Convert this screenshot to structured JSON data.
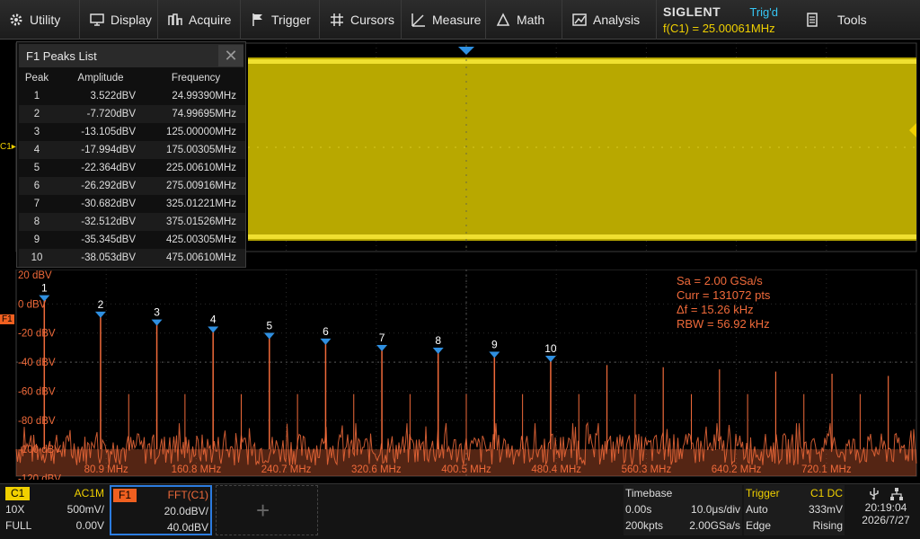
{
  "menu": [
    {
      "label": "Utility",
      "icon": "gear-icon"
    },
    {
      "label": "Display",
      "icon": "monitor-icon"
    },
    {
      "label": "Acquire",
      "icon": "acquire-icon"
    },
    {
      "label": "Trigger",
      "icon": "flag-icon"
    },
    {
      "label": "Cursors",
      "icon": "cursor-grid-icon"
    },
    {
      "label": "Measure",
      "icon": "measure-icon"
    },
    {
      "label": "Math",
      "icon": "math-icon"
    },
    {
      "label": "Analysis",
      "icon": "analysis-icon"
    },
    {
      "label": "Tools",
      "icon": "tools-icon"
    }
  ],
  "brand": {
    "logo": "SIGLENT",
    "status": "Trig'd",
    "freq": "f(C1) = 25.00061MHz"
  },
  "peaks_list": {
    "title": "F1 Peaks List",
    "columns": [
      "Peak",
      "Amplitude",
      "Frequency"
    ],
    "rows": [
      [
        "1",
        "3.522dBV",
        "24.99390MHz"
      ],
      [
        "2",
        "-7.720dBV",
        "74.99695MHz"
      ],
      [
        "3",
        "-13.105dBV",
        "125.00000MHz"
      ],
      [
        "4",
        "-17.994dBV",
        "175.00305MHz"
      ],
      [
        "5",
        "-22.364dBV",
        "225.00610MHz"
      ],
      [
        "6",
        "-26.292dBV",
        "275.00916MHz"
      ],
      [
        "7",
        "-30.682dBV",
        "325.01221MHz"
      ],
      [
        "8",
        "-32.512dBV",
        "375.01526MHz"
      ],
      [
        "9",
        "-35.345dBV",
        "425.00305MHz"
      ],
      [
        "10",
        "-38.053dBV",
        "475.00610MHz"
      ]
    ]
  },
  "markers": {
    "c1": "C1",
    "f1": "F1"
  },
  "fft_info": {
    "sa": "Sa =  2.00 GSa/s",
    "curr": "Curr = 131072 pts",
    "df": "Δf =  15.26 kHz",
    "rbw": "RBW =  56.92 kHz"
  },
  "chart_data": {
    "type": "line",
    "y_labels": [
      "20 dBV",
      "0 dBV",
      "-20 dBV",
      "-40 dBV",
      "-60 dBV",
      "-80 dBV",
      "-100 dBV",
      "-120 dBV"
    ],
    "x_labels": [
      "80.9 MHz",
      "160.8 MHz",
      "240.7 MHz",
      "320.6 MHz",
      "400.5 MHz",
      "480.4 MHz",
      "560.3 MHz",
      "640.2 MHz",
      "720.1 MHz"
    ],
    "peaks": [
      {
        "label": "1",
        "mhz": 24.99,
        "dbv": 3.522
      },
      {
        "label": "2",
        "mhz": 75.0,
        "dbv": -7.72
      },
      {
        "label": "3",
        "mhz": 125.0,
        "dbv": -13.105
      },
      {
        "label": "4",
        "mhz": 175.0,
        "dbv": -17.994
      },
      {
        "label": "5",
        "mhz": 225.0,
        "dbv": -22.364
      },
      {
        "label": "6",
        "mhz": 275.0,
        "dbv": -26.292
      },
      {
        "label": "7",
        "mhz": 325.0,
        "dbv": -30.682
      },
      {
        "label": "8",
        "mhz": 375.0,
        "dbv": -32.512
      },
      {
        "label": "9",
        "mhz": 425.0,
        "dbv": -35.345
      },
      {
        "label": "10",
        "mhz": 475.0,
        "dbv": -38.053
      }
    ],
    "xlim": [
      0,
      800
    ],
    "ylim": [
      -120,
      20
    ],
    "noise_floor_dbv": -100,
    "color": "#f06a3a"
  },
  "c1": {
    "label": "C1",
    "coupling": "AC1M",
    "probe": "10X",
    "scale": "500mV/",
    "bw": "FULL",
    "offset": "0.00V"
  },
  "f1": {
    "label": "F1",
    "source": "FFT(C1)",
    "scale": "20.0dBV/",
    "ref": "40.0dBV"
  },
  "timebase": {
    "title": "Timebase",
    "delay": "0.00s",
    "scale": "10.0μs/div",
    "points": "200kpts",
    "rate": "2.00GSa/s"
  },
  "trigger": {
    "title": "Trigger",
    "source": "C1 DC",
    "mode": "Auto",
    "level": "333mV",
    "type": "Edge",
    "slope": "Rising"
  },
  "clock": {
    "time": "20:19:04",
    "date": "2026/7/27"
  },
  "colors": {
    "ch1": "#f0d000",
    "fft": "#f06a3a",
    "accent": "#2c7ce0"
  }
}
